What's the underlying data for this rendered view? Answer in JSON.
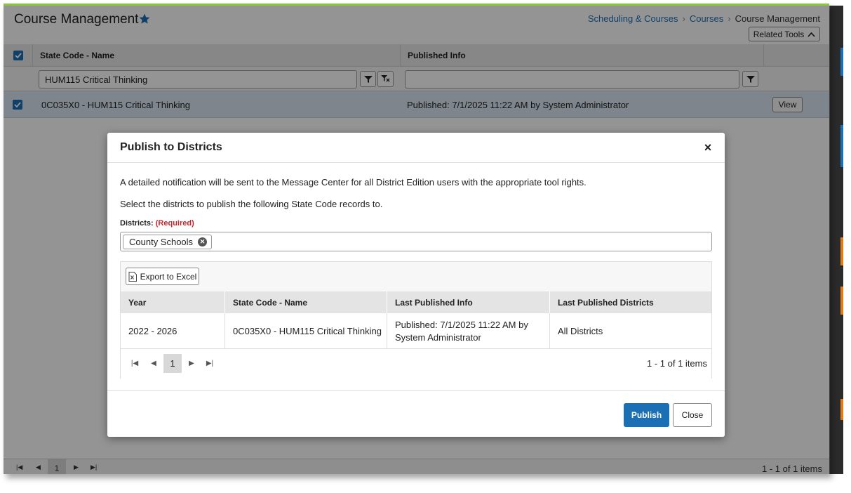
{
  "page": {
    "title": "Course Management",
    "breadcrumbs": [
      "Scheduling & Courses",
      "Courses",
      "Course Management"
    ],
    "related_tools_label": "Related Tools"
  },
  "grid": {
    "columns": [
      "State Code - Name",
      "Published Info"
    ],
    "filter_value": "HUM115 Critical Thinking",
    "row": {
      "name": "0C035X0 - HUM115 Critical Thinking",
      "published": "Published: 7/1/2025 11:22 AM by System Administrator",
      "view_label": "View"
    },
    "pager": {
      "page": "1",
      "info": "1 - 1 of 1 items"
    }
  },
  "modal": {
    "title": "Publish to Districts",
    "close_glyph": "×",
    "notice": "A detailed notification will be sent to the Message Center for all District Edition users with the appropriate tool rights.",
    "instruction": "Select the districts to publish the following State Code records to.",
    "districts_label": "Districts:",
    "required_label": "(Required)",
    "selected_district": "County Schools",
    "export_label": "Export to Excel",
    "table": {
      "headers": [
        "Year",
        "State Code - Name",
        "Last Published Info",
        "Last Published Districts"
      ],
      "row": [
        "2022 - 2026",
        "0C035X0 - HUM115 Critical Thinking",
        "Published: 7/1/2025 11:22 AM by System Administrator",
        "All Districts"
      ]
    },
    "pager": {
      "page": "1",
      "info": "1 - 1 of 1 items"
    },
    "publish_label": "Publish",
    "close_label": "Close"
  },
  "colors": {
    "accent": "#1a6fb5",
    "required": "#c0262d",
    "selected_row": "#d9e6f2",
    "top_border": "#8cc63f"
  }
}
